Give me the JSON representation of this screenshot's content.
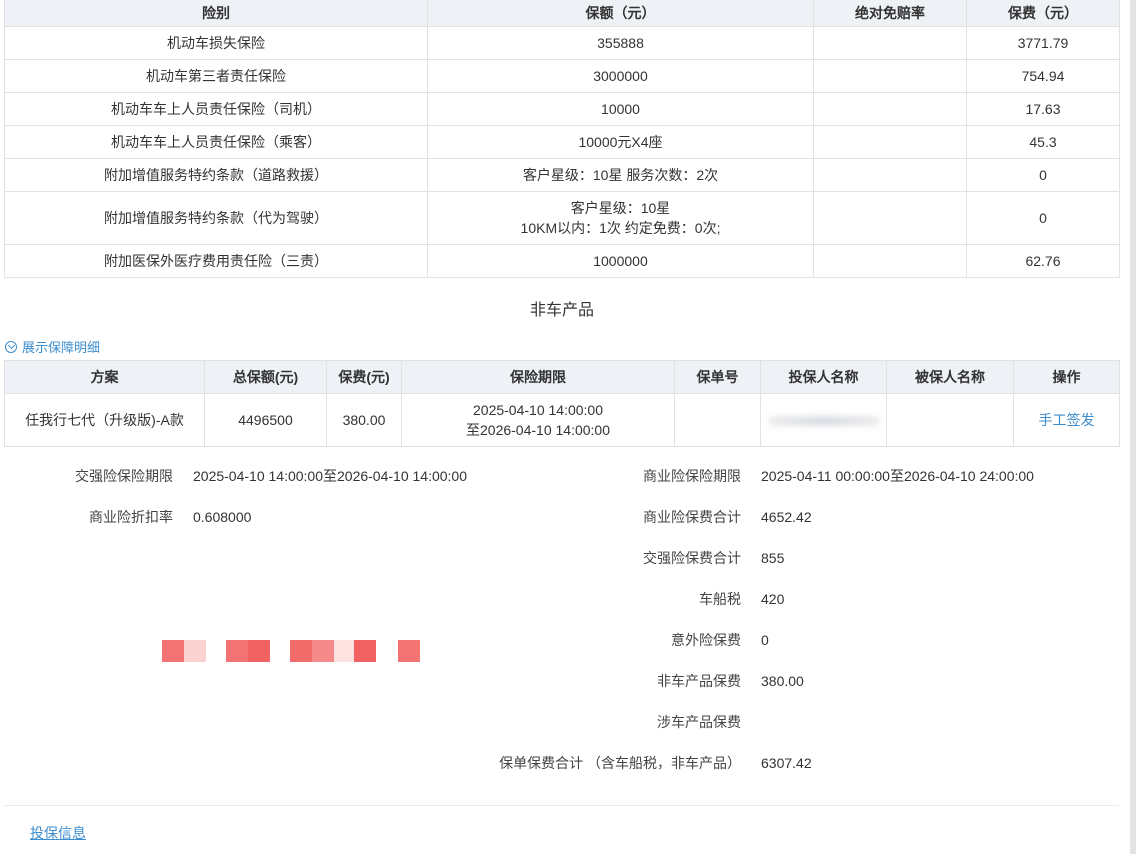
{
  "coverage_table": {
    "headers": [
      "险别",
      "保额（元）",
      "绝对免赔率",
      "保费（元）"
    ],
    "rows": [
      [
        "机动车损失保险",
        "355888",
        "",
        "3771.79"
      ],
      [
        "机动车第三者责任保险",
        "3000000",
        "",
        "754.94"
      ],
      [
        "机动车车上人员责任保险（司机）",
        "10000",
        "",
        "17.63"
      ],
      [
        "机动车车上人员责任保险（乘客）",
        "10000元X4座",
        "",
        "45.3"
      ],
      [
        "附加增值服务特约条款（道路救援）",
        "客户星级：10星 服务次数：2次",
        "",
        "0"
      ],
      [
        "附加增值服务特约条款（代为驾驶）",
        "客户星级：10星\n10KM以内：1次 约定免费：0次;",
        "",
        "0"
      ],
      [
        "附加医保外医疗费用责任险（三责）",
        "1000000",
        "",
        "62.76"
      ]
    ]
  },
  "non_vehicle": {
    "section_title": "非车产品",
    "toggle_label": "展示保障明细",
    "headers": [
      "方案",
      "总保额(元)",
      "保费(元)",
      "保险期限",
      "保单号",
      "投保人名称",
      "被保人名称",
      "操作"
    ],
    "row": {
      "plan": "任我行七代（升级版)-A款",
      "total_amount": "4496500",
      "premium": "380.00",
      "period_start": "2025-04-10 14:00:00",
      "period_end": "至2026-04-10 14:00:00",
      "policy_no": "",
      "insured_name": "",
      "action_label": "手工签发"
    }
  },
  "summary": {
    "left": [
      {
        "label": "交强险保险期限",
        "value": "2025-04-10 14:00:00至2026-04-10 14:00:00"
      },
      {
        "label": "商业险折扣率",
        "value": "0.608000"
      }
    ],
    "right": [
      {
        "label": "商业险保险期限",
        "value": "2025-04-11 00:00:00至2026-04-10 24:00:00"
      },
      {
        "label": "商业险保费合计",
        "value": "4652.42"
      },
      {
        "label": "交强险保费合计",
        "value": "855"
      },
      {
        "label": "车船税",
        "value": "420"
      },
      {
        "label": "意外险保费",
        "value": "0"
      },
      {
        "label": "非车产品保费",
        "value": "380.00"
      },
      {
        "label": "涉车产品保费",
        "value": ""
      },
      {
        "label": "保单保费合计 （含车船税，非车产品）",
        "value": "6307.42"
      }
    ]
  },
  "footer": {
    "link_label": "投保信息"
  },
  "colors": {
    "accent": "#3c8dce",
    "header_bg": "#eef1f6",
    "redaction": "#f26b6b"
  }
}
